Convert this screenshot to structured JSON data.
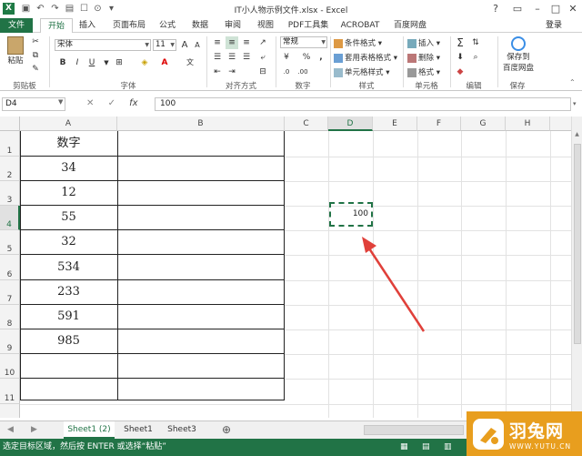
{
  "window": {
    "title": "IT小人物示例文件.xlsx - Excel"
  },
  "ribbon_tabs": [
    "文件",
    "开始",
    "插入",
    "页面布局",
    "公式",
    "数据",
    "审阅",
    "视图",
    "PDF工具集",
    "ACROBAT",
    "百度网盘"
  ],
  "user": {
    "login_label": "登录"
  },
  "ribbon": {
    "clipboard": {
      "paste_label": "粘贴",
      "group_label": "剪贴板"
    },
    "font": {
      "font_name": "宋体",
      "font_size": "11",
      "group_label": "字体",
      "bold": "B",
      "italic": "I",
      "underline": "U"
    },
    "alignment": {
      "group_label": "对齐方式"
    },
    "number": {
      "format": "常规",
      "percent": "%",
      "comma": ",",
      "group_label": "数字"
    },
    "styles": {
      "conditional": "条件格式",
      "table": "套用表格格式",
      "cell_styles": "单元格样式",
      "group_label": "样式"
    },
    "cells": {
      "insert": "插入",
      "delete": "删除",
      "format": "格式",
      "group_label": "单元格"
    },
    "editing": {
      "sigma": "Σ",
      "group_label": "编辑"
    },
    "save": {
      "label_line1": "保存到",
      "label_line2": "百度网盘",
      "group_label": "保存"
    }
  },
  "formula_bar": {
    "name_box": "D4",
    "fx": "fx",
    "content": "100"
  },
  "columns": [
    "A",
    "B",
    "C",
    "D",
    "E",
    "F",
    "G",
    "H"
  ],
  "rows": [
    "1",
    "2",
    "3",
    "4",
    "5",
    "6",
    "7",
    "8",
    "9",
    "10",
    "11"
  ],
  "cells_A": [
    "数字",
    "34",
    "12",
    "55",
    "32",
    "534",
    "233",
    "591",
    "985",
    "",
    ""
  ],
  "selected_cell": {
    "ref": "D4",
    "value": "100"
  },
  "sheets": [
    {
      "name": "Sheet1 (2)",
      "active": true
    },
    {
      "name": "Sheet1",
      "active": false
    },
    {
      "name": "Sheet3",
      "active": false
    }
  ],
  "status": {
    "message": "选定目标区域，然后按 ENTER 或选择“粘贴”"
  },
  "watermark": {
    "brand": "羽兔网",
    "url": "WWW.YUTU.CN"
  },
  "colors": {
    "accent": "#217346",
    "arrow": "#e0403a",
    "watermark": "#e89e1e"
  }
}
